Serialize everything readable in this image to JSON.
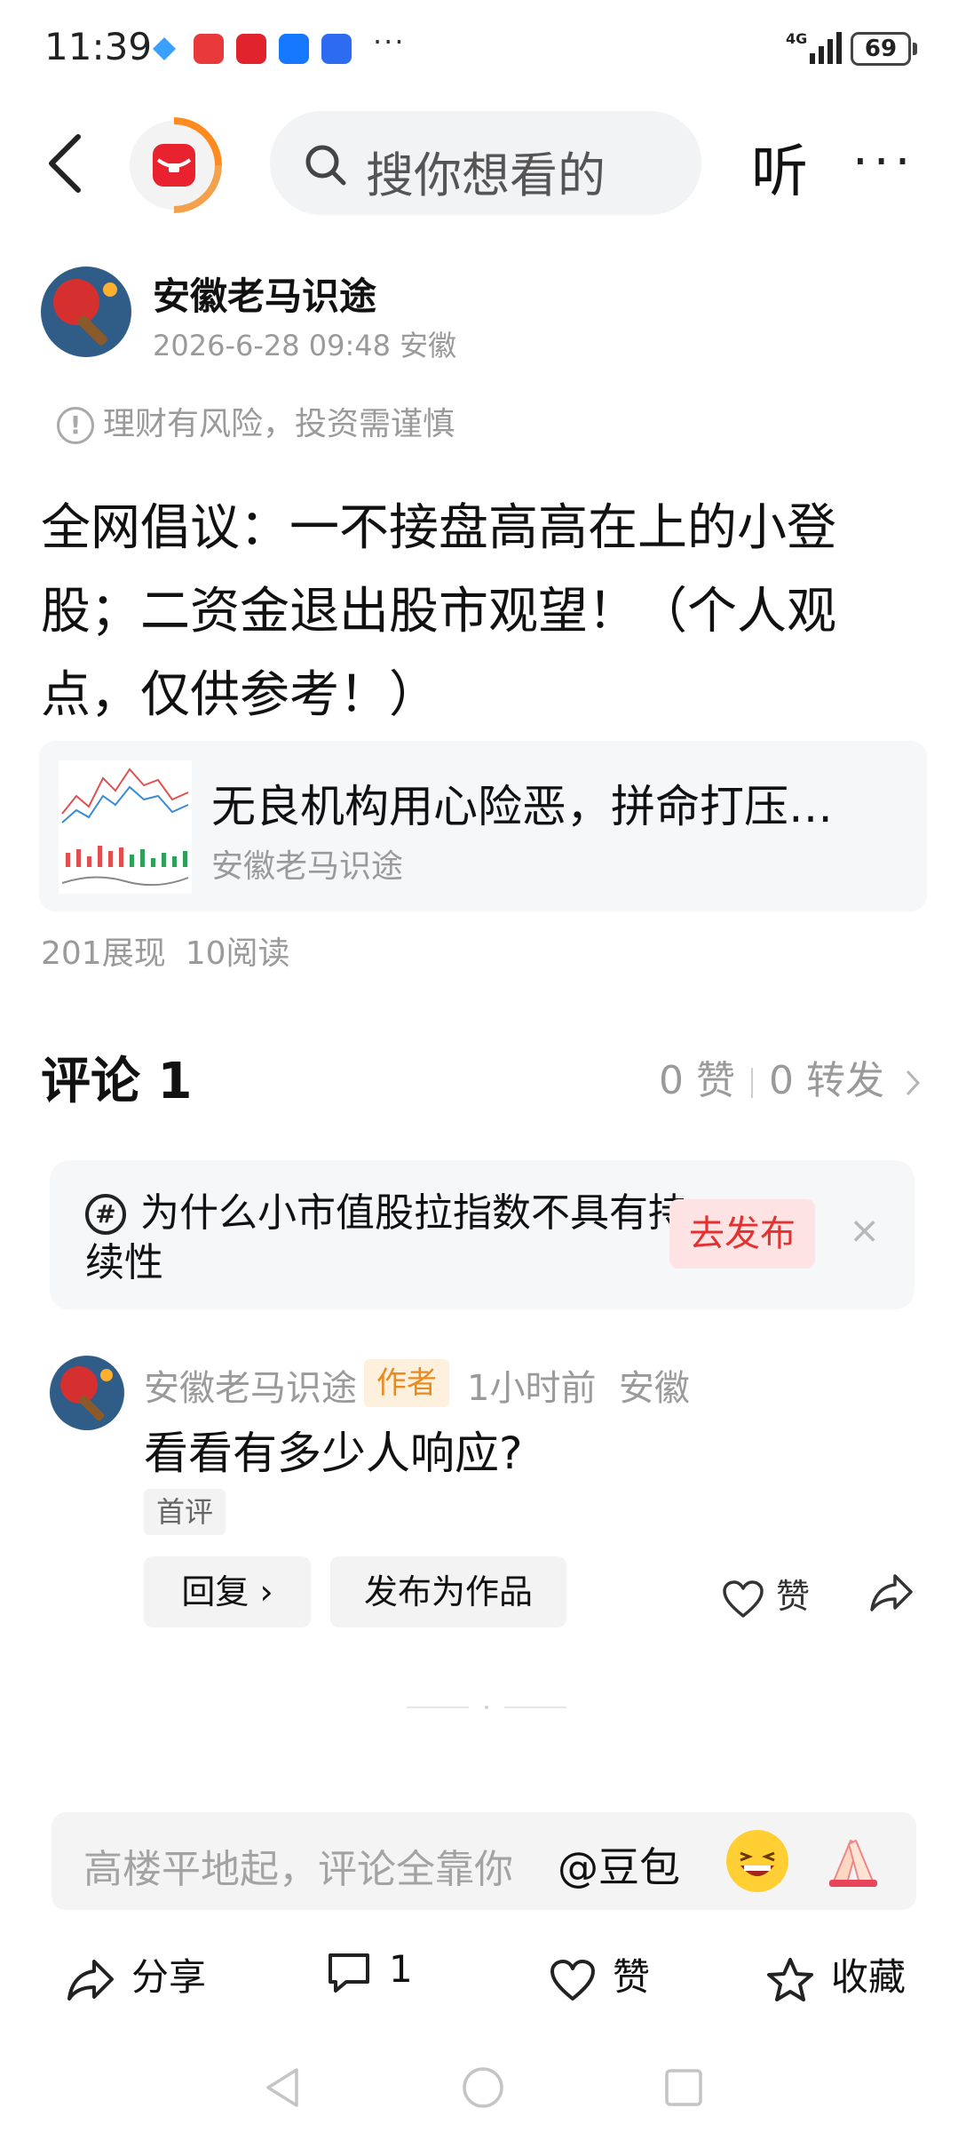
{
  "status_bar": {
    "time": "11:39",
    "more": "···",
    "network": "4G",
    "battery": "69",
    "app_icons": [
      "app-red-icon",
      "app-red-icon",
      "alipay-icon",
      "app-blue-icon"
    ]
  },
  "nav": {
    "search_placeholder": "搜你想看的",
    "listen_label": "听",
    "more_label": "···"
  },
  "post": {
    "author": "安徽老马识途",
    "meta": "2026-6-28 09:48 安徽",
    "risk_notice": "理财有风险，投资需谨慎",
    "risk_icon_glyph": "!",
    "title": "全网倡议：一不接盘高高在上的小登股；二资金退出股市观望！（个人观点，仅供参考！）",
    "linked_card": {
      "title": "无良机构用心险恶，拼命打压…",
      "source": "安徽老马识途"
    },
    "stats": {
      "impressions": "201展现",
      "reads": "10阅读"
    }
  },
  "comments_header": {
    "title": "评论 1",
    "likes": "0 赞",
    "forwards": "0 转发"
  },
  "topic_prompt": {
    "hash_glyph": "#",
    "text": "为什么小市值股拉指数不具有持续性",
    "button": "去发布",
    "close": "×"
  },
  "comment": {
    "author": "安徽老马识途",
    "badge": "作者",
    "time": "1小时前",
    "location": "安徽",
    "text": "看看有多少人响应?",
    "tag": "首评",
    "reply_label": "回复 ›",
    "publish_label": "发布为作品",
    "like_label": "赞"
  },
  "input_bar": {
    "placeholder": "高楼平地起，评论全靠你",
    "at_label": "@豆包"
  },
  "bottom_actions": {
    "share": "分享",
    "comments": "1",
    "like": "赞",
    "favorite": "收藏"
  },
  "colors": {
    "accent_red": "#e2312f",
    "badge_orange": "#e88a1f",
    "muted_text": "#9a9a9a"
  }
}
